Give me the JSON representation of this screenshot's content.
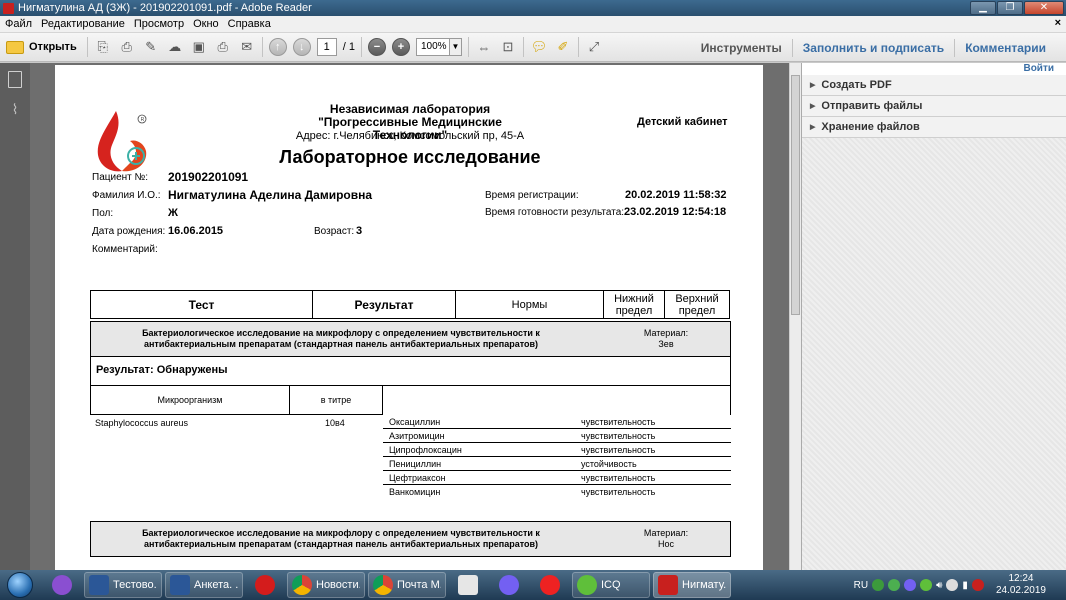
{
  "window": {
    "title": "Нигматулина АД (ЗЖ) - 201902201091.pdf - Adobe Reader"
  },
  "menu": [
    "Файл",
    "Редактирование",
    "Просмотр",
    "Окно",
    "Справка"
  ],
  "toolbar": {
    "open_label": "Открыть",
    "page_current": "1",
    "page_total": "/ 1",
    "zoom": "100%",
    "tools_label": "Инструменты",
    "fill_sign_label": "Заполнить и подписать",
    "comments_label": "Комментарии"
  },
  "right_panel": {
    "login_label": "Войти",
    "items": [
      "Создать PDF",
      "Отправить файлы",
      "Хранение файлов"
    ]
  },
  "document": {
    "lab_line1": "Независимая лаборатория",
    "lab_line2": "\"Прогрессивные Медицинские Технологии\"",
    "address": "Адрес: г.Челябинск, Комсомольский пр, 45-А",
    "title": "Лабораторное исследование",
    "cabinet": "Детский кабинет",
    "patient_no_label": "Пациент №:",
    "patient_no": "201902201091",
    "name_label": "Фамилия И.О.:",
    "name": "Нигматулина Аделина Дамировна",
    "sex_label": "Пол:",
    "sex": "Ж",
    "dob_label": "Дата рождения:",
    "dob": "16.06.2015",
    "age_label": "Возраст:",
    "age": "3",
    "comment_label": "Комментарий:",
    "reg_time_label": "Время регистрации:",
    "reg_time": "20.02.2019 11:58:32",
    "ready_time_label": "Время готовности результата:",
    "ready_time": "23.02.2019 12:54:18",
    "table_header": {
      "test": "Тест",
      "result": "Результат",
      "norms": "Нормы",
      "lower_1": "Нижний",
      "lower_2": "предел",
      "upper_1": "Верхний",
      "upper_2": "предел"
    },
    "study1": {
      "name_line1": "Бактериологическое исследование на микрофлору с определением чувствительности к",
      "name_line2": "антибактериальным препаратам (стандартная панель антибактериальных препаратов)",
      "material_label": "Материал:",
      "material": "Зев",
      "result": "Результат: Обнаружены",
      "micro_col": "Микроорганизм",
      "titer_col": "в титре",
      "organism": "Staphylococcus aureus",
      "titer": "10в4",
      "antibiotics": [
        {
          "name": "Оксациллин",
          "status": "чувствительность"
        },
        {
          "name": "Азитромицин",
          "status": "чувствительность"
        },
        {
          "name": "Ципрофлоксацин",
          "status": "чувствительность"
        },
        {
          "name": "Пенициллин",
          "status": "устойчивость"
        },
        {
          "name": "Цефтриаксон",
          "status": "чувствительность"
        },
        {
          "name": "Ванкомицин",
          "status": "чувствительность"
        }
      ]
    },
    "study2": {
      "name_line1": "Бактериологическое исследование на микрофлору с определением чувствительности к",
      "name_line2": "антибактериальным препаратам (стандартная панель антибактериальных препаратов)",
      "material_label": "Материал:",
      "material": "Нос"
    }
  },
  "taskbar": {
    "apps": [
      {
        "label": "Тестово...",
        "icon": "word-icon",
        "color": "#2b5797"
      },
      {
        "label": "Анкета. ...",
        "icon": "word-icon",
        "color": "#2b5797"
      },
      {
        "label": "Новости...",
        "icon": "chrome-icon",
        "color": "#e8a33d"
      },
      {
        "label": "Почта М...",
        "icon": "chrome-icon",
        "color": "#e8a33d"
      },
      {
        "label": "ICQ",
        "icon": "icq-icon",
        "color": "#5fbf3a"
      },
      {
        "label": "Нигмату...",
        "icon": "adobe-reader-icon",
        "color": "#c8201e"
      }
    ],
    "lang": "RU",
    "time": "12:24",
    "date": "24.02.2019"
  }
}
